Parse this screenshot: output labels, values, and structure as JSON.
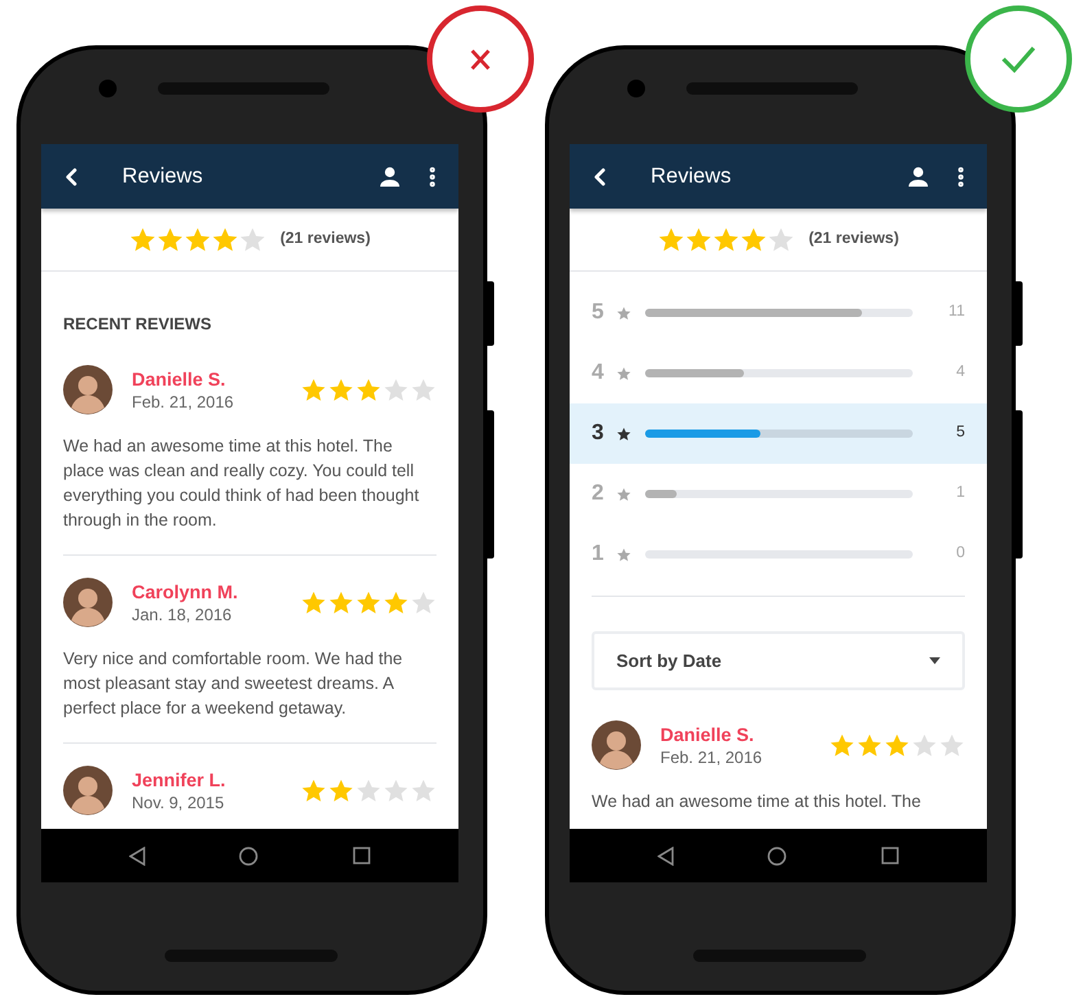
{
  "phones": [
    {
      "kind": "rejected",
      "title": "Reviews",
      "stars": 4,
      "count": "(21 reviews)",
      "blocks": [
        {
          "kind": "heading",
          "text": "RECENT REVIEWS"
        },
        {
          "kind": "review",
          "name": "Danielle S.",
          "date": "Feb. 21, 2016",
          "stars": 3,
          "text": "We had an awesome time at this hotel. The place was clean and really cozy. You could tell everything you could think of had been thought through in the room."
        },
        {
          "kind": "review",
          "name": "Carolynn M.",
          "date": "Jan. 18, 2016",
          "stars": 4,
          "text": "Very nice and comfortable room. We had the most pleasant stay and sweetest dreams. A perfect place for a weekend getaway."
        },
        {
          "kind": "review",
          "name": "Jennifer L.",
          "date": "Nov. 9, 2015",
          "stars": 2
        }
      ]
    },
    {
      "kind": "approved",
      "title": "Reviews",
      "stars": 4,
      "count": "(21 reviews)",
      "blocks": [
        {
          "kind": "histogram",
          "rows": [
            {
              "label": "5",
              "count": "11",
              "level": 0.81,
              "selected": false
            },
            {
              "label": "4",
              "count": "4",
              "level": 0.37,
              "selected": false
            },
            {
              "label": "3",
              "count": "5",
              "level": 0.43,
              "selected": true
            },
            {
              "label": "2",
              "count": "1",
              "level": 0.12,
              "selected": false
            },
            {
              "label": "1",
              "count": "0",
              "level": 0,
              "selected": false
            }
          ]
        },
        {
          "kind": "sort",
          "value": "Sort by Date"
        },
        {
          "kind": "review",
          "name": "Danielle S.",
          "date": "Feb. 21, 2016",
          "stars": 3,
          "text": "We had an awesome time at this hotel. The"
        }
      ]
    }
  ]
}
